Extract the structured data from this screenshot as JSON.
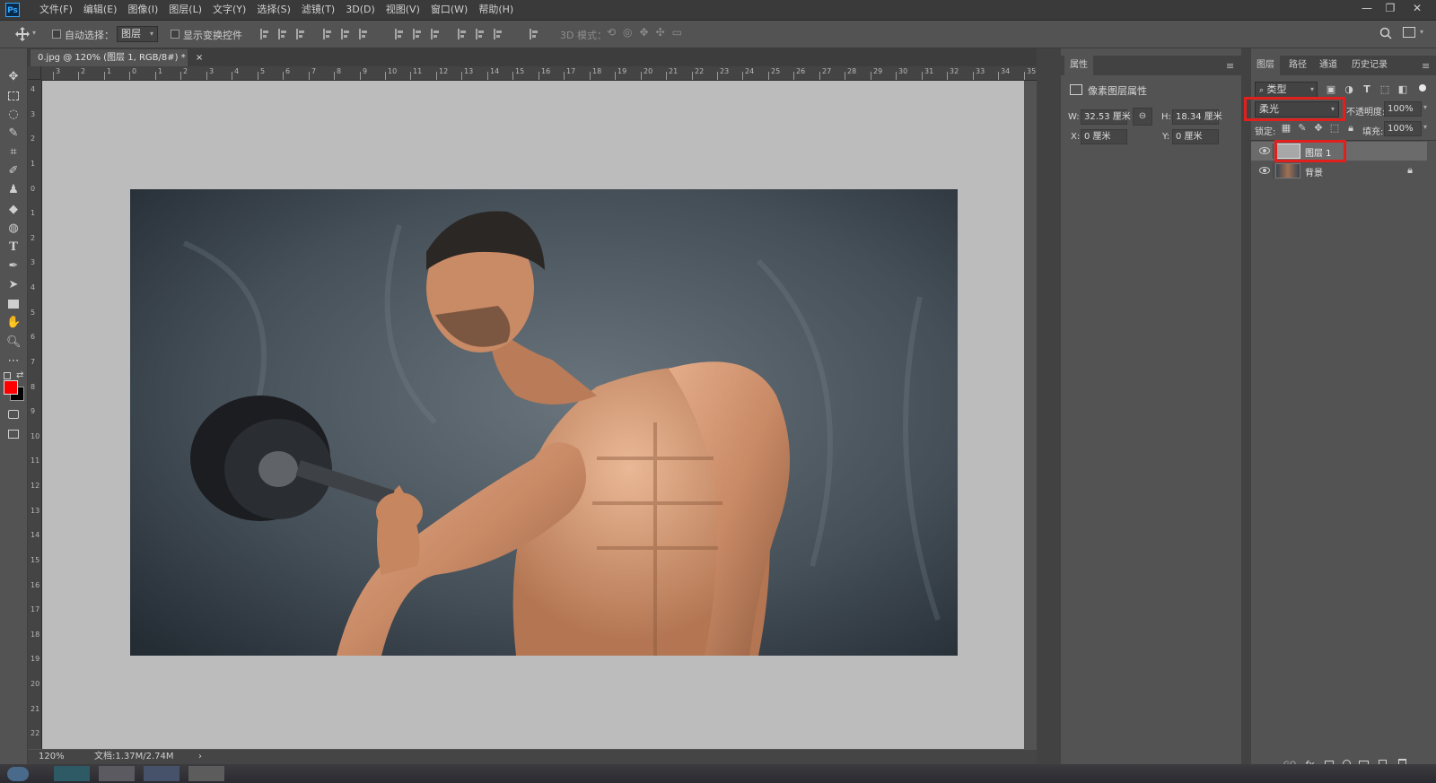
{
  "app": {
    "logo": "Ps"
  },
  "menu": [
    "文件(F)",
    "编辑(E)",
    "图像(I)",
    "图层(L)",
    "文字(Y)",
    "选择(S)",
    "滤镜(T)",
    "3D(D)",
    "视图(V)",
    "窗口(W)",
    "帮助(H)"
  ],
  "window_controls": {
    "minimize": "—",
    "restore": "❐",
    "close": "✕"
  },
  "options_bar": {
    "auto_select_label": "自动选择：",
    "auto_select_value": "图层",
    "show_transform_label": "显示变换控件",
    "mode_3d_label": "3D 模式："
  },
  "document": {
    "tab_title": "0.jpg @ 120% (图层 1, RGB/8#) *",
    "close_glyph": "×",
    "zoom": "120%",
    "doc_info": "文档:1.37M/2.74M",
    "arrow": "›"
  },
  "ruler": {
    "top_ticks": [
      "3",
      "2",
      "1",
      "0",
      "1",
      "2",
      "3",
      "4",
      "5",
      "6",
      "7",
      "8",
      "9",
      "10",
      "11",
      "12",
      "13",
      "14",
      "15",
      "16",
      "17",
      "18",
      "19",
      "20",
      "21",
      "22",
      "23",
      "24",
      "25",
      "26",
      "27",
      "28",
      "29",
      "30",
      "31",
      "32",
      "33",
      "34",
      "35"
    ],
    "left_ticks": [
      "4",
      "3",
      "2",
      "1",
      "0",
      "1",
      "2",
      "3",
      "4",
      "5",
      "6",
      "7",
      "8",
      "9",
      "10",
      "11",
      "12",
      "13",
      "14",
      "15",
      "16",
      "17",
      "18",
      "19",
      "20",
      "21",
      "22"
    ]
  },
  "properties": {
    "tab": "属性",
    "header": "像素图层属性",
    "w_label": "W:",
    "w_value": "32.53 厘米",
    "h_label": "H:",
    "h_value": "18.34 厘米",
    "x_label": "X:",
    "x_value": "0 厘米",
    "y_label": "Y:",
    "y_value": "0 厘米"
  },
  "layers": {
    "tabs": [
      "图层",
      "路径",
      "通道",
      "历史记录"
    ],
    "filter_label": "类型",
    "blend_mode": "柔光",
    "opacity_label": "不透明度:",
    "opacity_value": "100%",
    "lock_label": "锁定:",
    "fill_label": "填充:",
    "fill_value": "100%",
    "items": [
      {
        "name": "图层 1"
      },
      {
        "name": "背景"
      }
    ],
    "footer_icons": [
      "GO",
      "fx"
    ]
  },
  "colors": {
    "foreground": "#ff0000",
    "background": "#000000",
    "highlight": "#e0201c"
  }
}
